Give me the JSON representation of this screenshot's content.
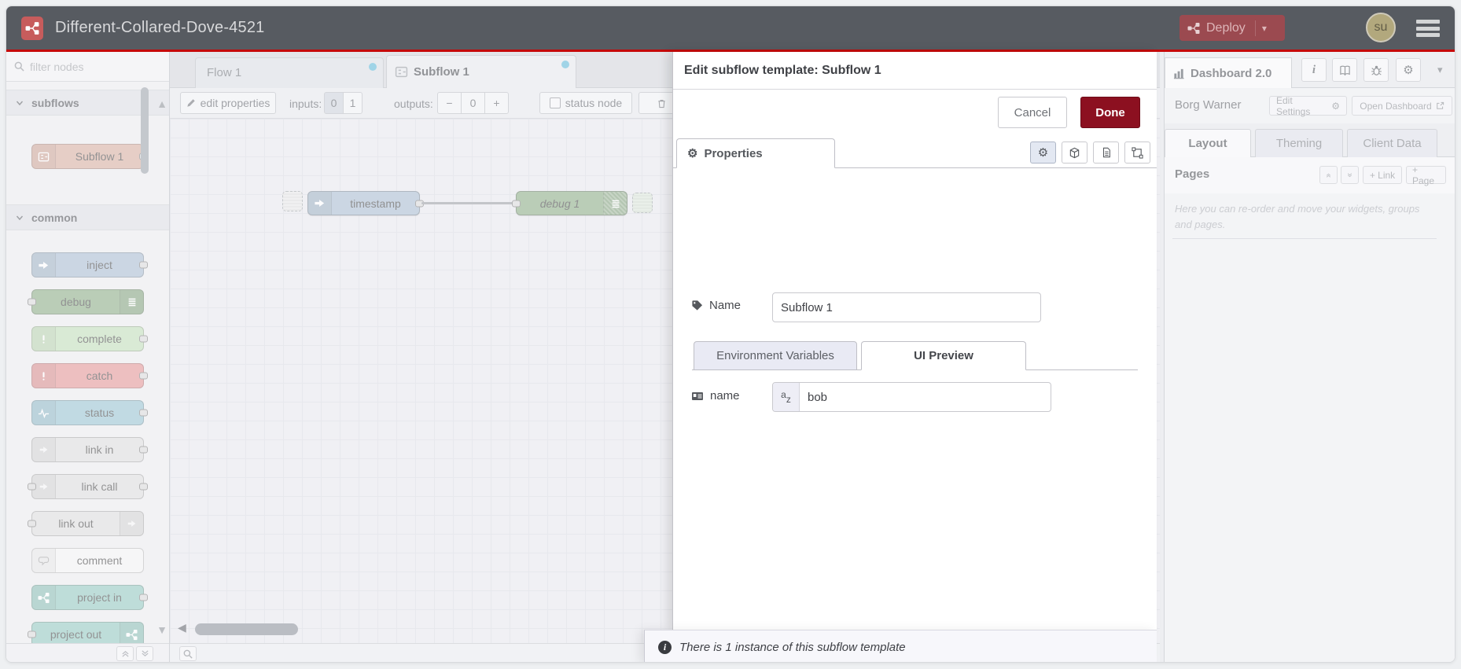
{
  "colors": {
    "header_bg": "#575b61",
    "accent_line": "#c50a0a",
    "deploy_bg": "#9b4a50",
    "done_bg": "#8c1020",
    "dirty_dot": "#58b7d8",
    "avatar_bg": "#b2a87d"
  },
  "header": {
    "title": "Different-Collared-Dove-4521",
    "deploy_label": "Deploy",
    "user_initials": "su"
  },
  "palette": {
    "filter_placeholder": "filter nodes",
    "categories": [
      {
        "label": "subflows",
        "items": [
          {
            "label": "Subflow 1",
            "color": "#d8ab9c",
            "icon": "subflow",
            "icon_side": "left",
            "ports": "right"
          }
        ]
      },
      {
        "label": "common",
        "items": [
          {
            "label": "inject",
            "color": "#a6bbcf",
            "icon": "inject",
            "icon_side": "left",
            "ports": "right"
          },
          {
            "label": "debug",
            "color": "#87a980",
            "icon": "debug",
            "icon_side": "right",
            "ports": "left"
          },
          {
            "label": "complete",
            "color": "#c0deb6",
            "icon": "bang",
            "icon_side": "left",
            "ports": "right"
          },
          {
            "label": "catch",
            "color": "#e49191",
            "icon": "bang",
            "icon_side": "left",
            "ports": "right"
          },
          {
            "label": "status",
            "color": "#94c1d0",
            "icon": "status",
            "icon_side": "left",
            "ports": "right"
          },
          {
            "label": "link in",
            "color": "#dddddd",
            "icon": "link",
            "icon_side": "left",
            "ports": "right"
          },
          {
            "label": "link call",
            "color": "#dddddd",
            "icon": "link",
            "icon_side": "left",
            "ports": "both"
          },
          {
            "label": "link out",
            "color": "#dddddd",
            "icon": "link",
            "icon_side": "right",
            "ports": "left"
          },
          {
            "label": "comment",
            "color": "#f4f4f4",
            "icon": "comment",
            "icon_side": "left",
            "ports": "none"
          },
          {
            "label": "project in",
            "color": "#8fc7bd",
            "icon": "project",
            "icon_side": "left",
            "ports": "right"
          },
          {
            "label": "project out",
            "color": "#8fc7bd",
            "icon": "project",
            "icon_side": "right",
            "ports": "left"
          }
        ]
      }
    ]
  },
  "workspace": {
    "tabs": [
      {
        "label": "Flow 1",
        "dirty": true,
        "active": false
      },
      {
        "label": "Subflow 1",
        "dirty": true,
        "active": true
      }
    ],
    "toolbar": {
      "edit_properties": "edit properties",
      "inputs_label": "inputs:",
      "input_zero": "0",
      "input_one": "1",
      "outputs_label": "outputs:",
      "minus": "−",
      "output_count": "0",
      "plus": "+",
      "status_node": "status node"
    },
    "nodes": [
      {
        "label": "timestamp",
        "color": "#a6bbcf"
      },
      {
        "label": "debug 1",
        "color": "#87a980"
      }
    ]
  },
  "dialog": {
    "title": "Edit subflow template: Subflow 1",
    "cancel": "Cancel",
    "done": "Done",
    "properties_tab": "Properties",
    "name_label": "Name",
    "name_value": "Subflow 1",
    "env_tab": "Environment Variables",
    "ui_tab": "UI Preview",
    "field_label": "name",
    "field_value": "bob",
    "footer": "There is 1 instance of this subflow template"
  },
  "sidebar": {
    "tab": "Dashboard 2.0",
    "board": "Borg Warner",
    "edit_settings": "Edit Settings",
    "open_dashboard": "Open Dashboard",
    "tabs": [
      "Layout",
      "Theming",
      "Client Data"
    ],
    "pages": "Pages",
    "add_link": "+ Link",
    "add_page": "+ Page",
    "help": "Here you can re-order and move your widgets, groups and pages."
  }
}
